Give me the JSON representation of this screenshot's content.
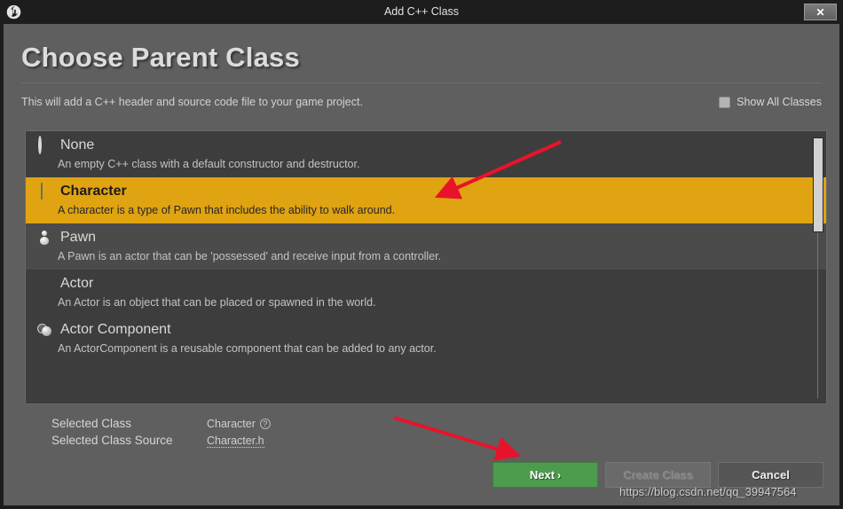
{
  "window": {
    "title": "Add C++ Class",
    "logo_icon": "unreal-engine-logo",
    "close_label": "✕"
  },
  "header": {
    "page_title": "Choose Parent Class",
    "subtitle": "This will add a C++ header and source code file to your game project.",
    "show_all_label": "Show All Classes",
    "show_all_checked": false
  },
  "class_list": {
    "items": [
      {
        "name": "None",
        "description": "An empty C++ class with a default constructor and destructor.",
        "icon": "ring-icon",
        "state": "normal"
      },
      {
        "name": "Character",
        "description": "A character is a type of Pawn that includes the ability to walk around.",
        "icon": "capsule-icon",
        "state": "selected"
      },
      {
        "name": "Pawn",
        "description": "A Pawn is an actor that can be 'possessed' and receive input from a controller.",
        "icon": "pawn-icon",
        "state": "hover"
      },
      {
        "name": "Actor",
        "description": "An Actor is an object that can be placed or spawned in the world.",
        "icon": "sphere-icon",
        "state": "normal"
      },
      {
        "name": "Actor Component",
        "description": "An ActorComponent is a reusable component that can be added to any actor.",
        "icon": "component-icon",
        "state": "normal"
      }
    ]
  },
  "selected_info": {
    "class_label": "Selected Class",
    "class_value": "Character",
    "help_icon": "?",
    "source_label": "Selected Class Source",
    "source_value": "Character.h"
  },
  "buttons": {
    "next": "Next",
    "next_chevron": "›",
    "create_class": "Create Class",
    "cancel": "Cancel"
  },
  "annotations": {
    "arrow_color": "#e8132b",
    "arrow_1_target": "character-row",
    "arrow_2_target": "next-button",
    "watermark": "https://blog.csdn.net/qq_39947564"
  },
  "colors": {
    "dialog_bg": "#5f5f5f",
    "titlebar_bg": "#1d1d1d",
    "list_bg": "#3d3d3d",
    "row_alt_bg": "#4b4b4b",
    "selected_row": "#e0a311",
    "next_green": "#4d9c4d",
    "arrow_red": "#e8132b"
  }
}
